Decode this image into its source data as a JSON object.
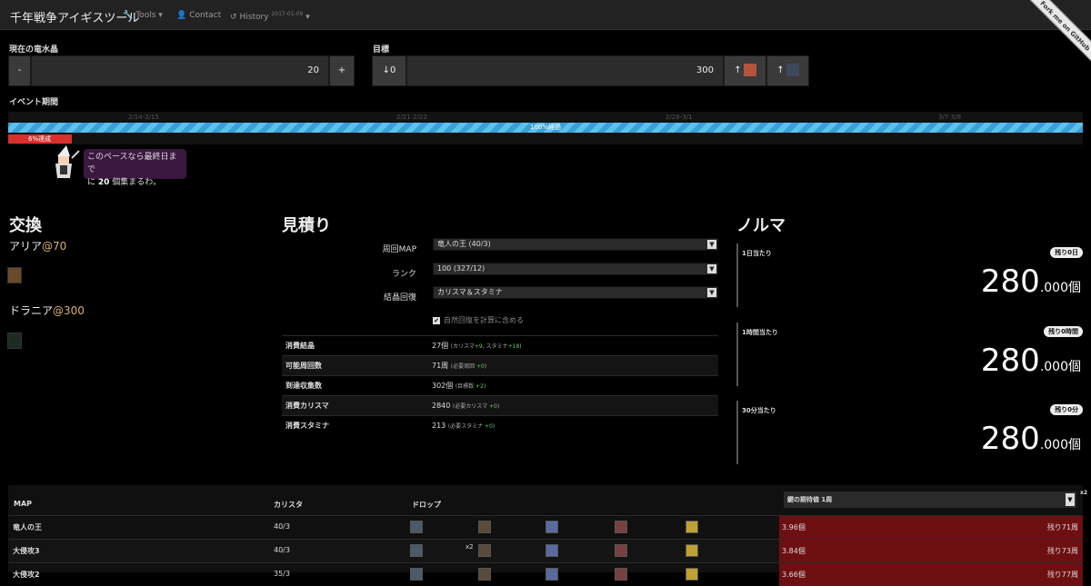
{
  "navbar": {
    "brand": "千年戦争アイギスツール",
    "tools": "Tools",
    "contact": "Contact",
    "history": "History",
    "history_date": "2017-01-09",
    "ribbon": "Fork me on GitHub"
  },
  "current": {
    "label": "現在の竜水晶",
    "minus": "-",
    "value": "20",
    "plus": "+"
  },
  "goal": {
    "label": "目標",
    "down": "↓0",
    "value": "300",
    "up1": "↑",
    "up2": "↑"
  },
  "period": {
    "label": "イベント期間",
    "ticks": [
      "2/14-2/15",
      "2/21-2/22",
      "2/28-3/1",
      "3/7-3/8"
    ],
    "elapsed": "100%経過",
    "achieved": "6%達成",
    "elapsed_pct": 100,
    "achieved_pct": 6
  },
  "speech": {
    "line1": "このペースなら最終日まで",
    "pre": "に ",
    "count": "20",
    "post": " 個集まるわ。"
  },
  "exchange": {
    "title": "交換",
    "items": [
      {
        "name": "アリア",
        "cost": "@70"
      },
      {
        "name": "ドラニア",
        "cost": "@300"
      }
    ]
  },
  "estimate": {
    "title": "見積り",
    "map_label": "周回MAP",
    "map_value": "竜人の王 (40/3)",
    "rank_label": "ランク",
    "rank_value": "100 (327/12)",
    "recover_label": "結晶回復",
    "recover_value": "カリスマ＆スタミナ",
    "natural": "自然回復を計算に含める",
    "rows": [
      {
        "k": "消費結晶",
        "v": "27個",
        "pre": "(カリスマ",
        "g1": "+9",
        "mid": ", スタミナ",
        "g2": "+18",
        "post": ")"
      },
      {
        "k": "可能周回数",
        "v": "71周",
        "pre": "(必要周回 ",
        "g1": "+0",
        "mid": "",
        "g2": "",
        "post": ")"
      },
      {
        "k": "到達収集数",
        "v": "302個",
        "pre": "(目標数 ",
        "g1": "+2",
        "mid": "",
        "g2": "",
        "post": ")"
      },
      {
        "k": "消費カリスマ",
        "v": "2840",
        "pre": "(必要カリスマ ",
        "g1": "+0",
        "mid": "",
        "g2": "",
        "post": ")"
      },
      {
        "k": "消費スタミナ",
        "v": "213",
        "pre": "(必要スタミナ ",
        "g1": "+0",
        "mid": "",
        "g2": "",
        "post": ")"
      }
    ]
  },
  "quota": {
    "title": "ノルマ",
    "cards": [
      {
        "label": "1日当たり",
        "badge": "残り0日",
        "value": "280",
        "dec": ".000",
        "unit": "個"
      },
      {
        "label": "1時間当たり",
        "badge": "残り0時間",
        "value": "280",
        "dec": ".000",
        "unit": "個"
      },
      {
        "label": "30分当たり",
        "badge": "残り0分",
        "value": "280",
        "dec": ".000",
        "unit": "個"
      }
    ]
  },
  "map_table": {
    "headers": {
      "map": "MAP",
      "charisma": "カリスタ",
      "drop": "ドロップ",
      "expect": "鍵の期待値 1周"
    },
    "x2_header": "x2",
    "rows": [
      {
        "name": "竜人の王",
        "charisma": "40/3",
        "x2": "",
        "exp": "3.96個",
        "rest": "残り71周"
      },
      {
        "name": "大侵攻3",
        "charisma": "40/3",
        "x2": "x2",
        "exp": "3.84個",
        "rest": "残り73周"
      },
      {
        "name": "大侵攻2",
        "charisma": "35/3",
        "x2": "",
        "exp": "3.66個",
        "rest": "残り77周"
      }
    ]
  },
  "colors": {
    "accent_red": "#d9302c",
    "progress_blue": "#3aa0d8",
    "expect_bg": "#6e0f12",
    "speech_bg": "#3b1840"
  }
}
